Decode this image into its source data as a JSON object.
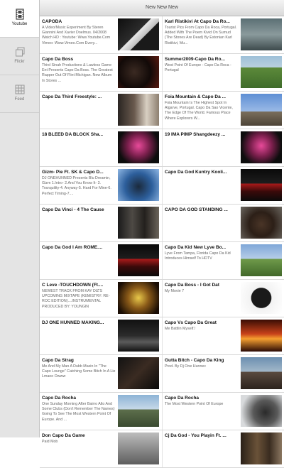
{
  "sidebar": {
    "items": [
      {
        "label": "Youtube",
        "icon": "film-icon",
        "active": true
      },
      {
        "label": "Flickr",
        "icon": "photo-icon",
        "active": false
      },
      {
        "label": "Feed",
        "icon": "grid-icon",
        "active": false
      }
    ]
  },
  "header": {
    "title": "New New New"
  },
  "videos": [
    {
      "title": "CAPODA",
      "desc": "A Video/Music Experiment By Steren Giannini And Xavier Doelmus. 04/2008 Watch HD : Youtube: Www.Youtube.Com Vimeo: Www.Vimeo.Com Every...",
      "thumb": "dark-graphic"
    },
    {
      "title": "Karl Ristikivi At Capo Da Ro...",
      "desc": "Tourist Pics From Capo Da Roca, Portugal. Added With The Poem Kivid On Sumud (The Stones Are Dead) By Estonian Karl Ristikivi, Mu...",
      "thumb": "coast-text"
    },
    {
      "title": "Capo Da Boss",
      "desc": "Third Sinah Productions & Lawless Game Ent Presents Capo Da Boss. The Greatest Rapper Out Of Flint Michigan. New Album In Stores ...",
      "thumb": "album-red"
    },
    {
      "title": "Summer2009-Capo Da Ro...",
      "desc": "West Point Of Europe - Capo Da Roca - Portugal",
      "thumb": "green-landscape"
    },
    {
      "title": "Capo Da Third Freestyle: ...",
      "desc": "",
      "thumb": "people-room"
    },
    {
      "title": "Foia Mountain & Capo Da ...",
      "desc": "Foia Mountain Is The Highest Spot In Algarve, Portugal. Capo Da Sao Vicente, The Edge Of The World. Famous Place Where Explorers W...",
      "thumb": "blue-sky"
    },
    {
      "title": "18 BLEED DA BLOCK Sha...",
      "desc": "",
      "thumb": "pink-cover"
    },
    {
      "title": "19 IMA PIMP Shangdeezy ...",
      "desc": "",
      "thumb": "pink-cover"
    },
    {
      "title": "Gizm- Pie Ft. SK & Capo D...",
      "desc": "DJ ONEHUNNED Presents Blu Dreamin, Gizm 1.Intro- 2.And You Know It- 3. Tranquility-4. Anyway-5. Hard For Mine-6. Perfect Timing-7....",
      "thumb": "blue-portrait"
    },
    {
      "title": "Capo Da God Kuntry Kooli...",
      "desc": "",
      "thumb": "dark-cover"
    },
    {
      "title": "Capo Da Vinci - 4 The Cause",
      "desc": "",
      "thumb": "studio"
    },
    {
      "title": "CAPO DA GOD STANDING ...",
      "desc": "",
      "thumb": "face-closeup"
    },
    {
      "title": "Capo Da God I Am ROME....",
      "desc": "",
      "thumb": "dark-cover"
    },
    {
      "title": "Capo Da Kid New Lyve Bo...",
      "desc": "Lyve From Tampa, Florida Capo Da Kid Introduces Himself To HDTV",
      "thumb": "outdoor-person"
    },
    {
      "title": "C Leve -TOUCHDOWN (Ft....",
      "desc": "NEWEST TRACK FROM KAY DIZ'S UPCOMING MIXTAPE (KEMISTRY: RE-ROC EDITION)....INSTRUMENTAL PRODUCED BY: YOUNGIN",
      "thumb": "gold-cover"
    },
    {
      "title": "Capo Da Boss - I Got Dat",
      "desc": "My Movie 7",
      "thumb": "lawless-logo"
    },
    {
      "title": "DJ ONE HUNNED MAKING...",
      "desc": "",
      "thumb": "dark-studio"
    },
    {
      "title": "Capo Vs Capo Da Great",
      "desc": "Me Battlin Myself.!",
      "thumb": "fire-text"
    },
    {
      "title": "Capo Da Strag",
      "desc": "Me And My Man A Dubb Maxin In \"The Capo Lounge\" Catching Some Bitch In A Lie Lmaoo Owww",
      "thumb": "dark-room"
    },
    {
      "title": "Gutta Bitch - Capo Da King",
      "desc": "Prod. By Dj One Hunnec",
      "thumb": "man-sky"
    },
    {
      "title": "Capo Da Rocha",
      "desc": "One Sunday Morning After Bairro Alto And Some Clubs (Don't Remember The Names) Going To See The Most Western Point Of Europe. And ...",
      "thumb": "hill-sky"
    },
    {
      "title": "Capo Da Rocha",
      "desc": "The Most Western Point Of Europe",
      "thumb": "person-closeup"
    },
    {
      "title": "Don Capo Da Game",
      "desc": "Paid Mob",
      "thumb": "gray-photo"
    },
    {
      "title": "Cj Da God - You Playin Ft. ...",
      "desc": "",
      "thumb": "crowd"
    }
  ]
}
